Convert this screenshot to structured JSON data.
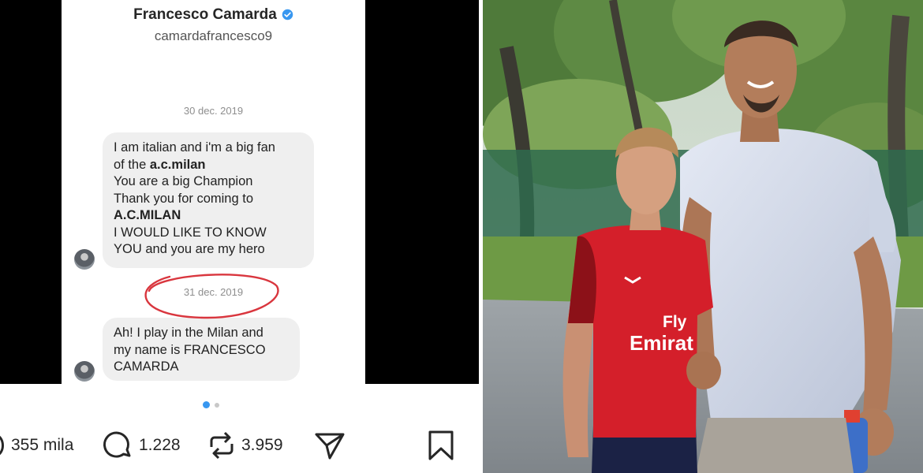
{
  "profile": {
    "name": "Francesco Camarda",
    "handle": "camardafrancesco9",
    "verified_color": "#3897f0"
  },
  "messages": [
    {
      "date": "30 dec. 2019",
      "lines": [
        {
          "text": "I  am italian and i'm a big fan",
          "strong": false
        },
        {
          "text": "of the a.c.milan",
          "strong": false
        },
        {
          "text": "You are a big Champion",
          "strong": false
        },
        {
          "text": "Thank you for coming to",
          "strong": false
        },
        {
          "text": "A.C.MILAN",
          "strong": true
        },
        {
          "text": "I WOULD LIKE TO KNOW",
          "strong": false
        },
        {
          "text": "YOU and you are my hero",
          "strong": false
        }
      ]
    },
    {
      "date": "31 dec. 2019",
      "lines": [
        {
          "text": "Ah! I play in the Milan and",
          "strong": false
        },
        {
          "text": "my name is FRANCESCO",
          "strong": false
        },
        {
          "text": "CAMARDA",
          "strong": false
        }
      ]
    }
  ],
  "annotation_color": "#d9363e",
  "carousel": {
    "current": 1,
    "total": 2,
    "active_color": "#3897f0"
  },
  "actions": {
    "likes": "355 mila",
    "comments": "1.228",
    "reposts": "3.959"
  },
  "photo": {
    "jersey_text_1": "Fly",
    "jersey_text_2": "Emirat",
    "jersey_color": "#d41f2a"
  }
}
